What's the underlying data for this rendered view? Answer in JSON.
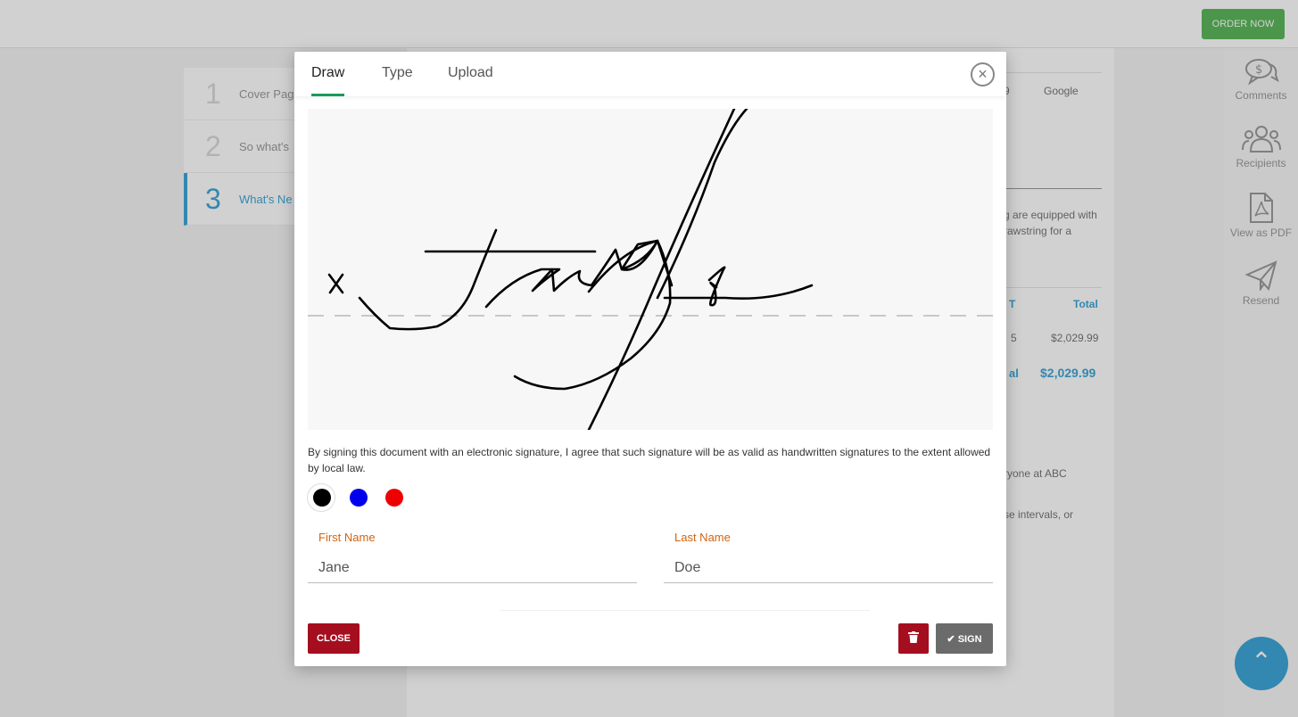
{
  "topbar": {
    "order_button": "ORDER NOW"
  },
  "steps": [
    {
      "num": "1",
      "label": "Cover Pag"
    },
    {
      "num": "2",
      "label": "So what's"
    },
    {
      "num": "3",
      "label": "What's Ne"
    }
  ],
  "document": {
    "col_partial": "9",
    "col_google": "Google",
    "para1_line1": "g are equipped with",
    "para1_line2": "rawstring for a",
    "th_partial": "T",
    "th_total": "Total",
    "row_partial": "5",
    "row_total": "$2,029.99",
    "total_label_partial": "al",
    "total_value": "$2,029.99",
    "para2": "ryone at ABC",
    "para3": "se intervals, or"
  },
  "rightbar": {
    "comments": "Comments",
    "recipients": "Recipients",
    "view_pdf": "View as PDF",
    "resend": "Resend"
  },
  "modal": {
    "tabs": {
      "draw": "Draw",
      "type": "Type",
      "upload": "Upload"
    },
    "consent": "By signing this document with an electronic signature, I agree that such signature will be as valid as handwritten signatures to the extent allowed by local law.",
    "colors": {
      "black": "#000000",
      "blue": "#0000ee",
      "red": "#ee0000",
      "selected": "black"
    },
    "first_name_label": "First Name",
    "first_name_value": "Jane",
    "last_name_label": "Last Name",
    "last_name_value": "Doe",
    "close_label": "CLOSE",
    "sign_label": "SIGN"
  }
}
